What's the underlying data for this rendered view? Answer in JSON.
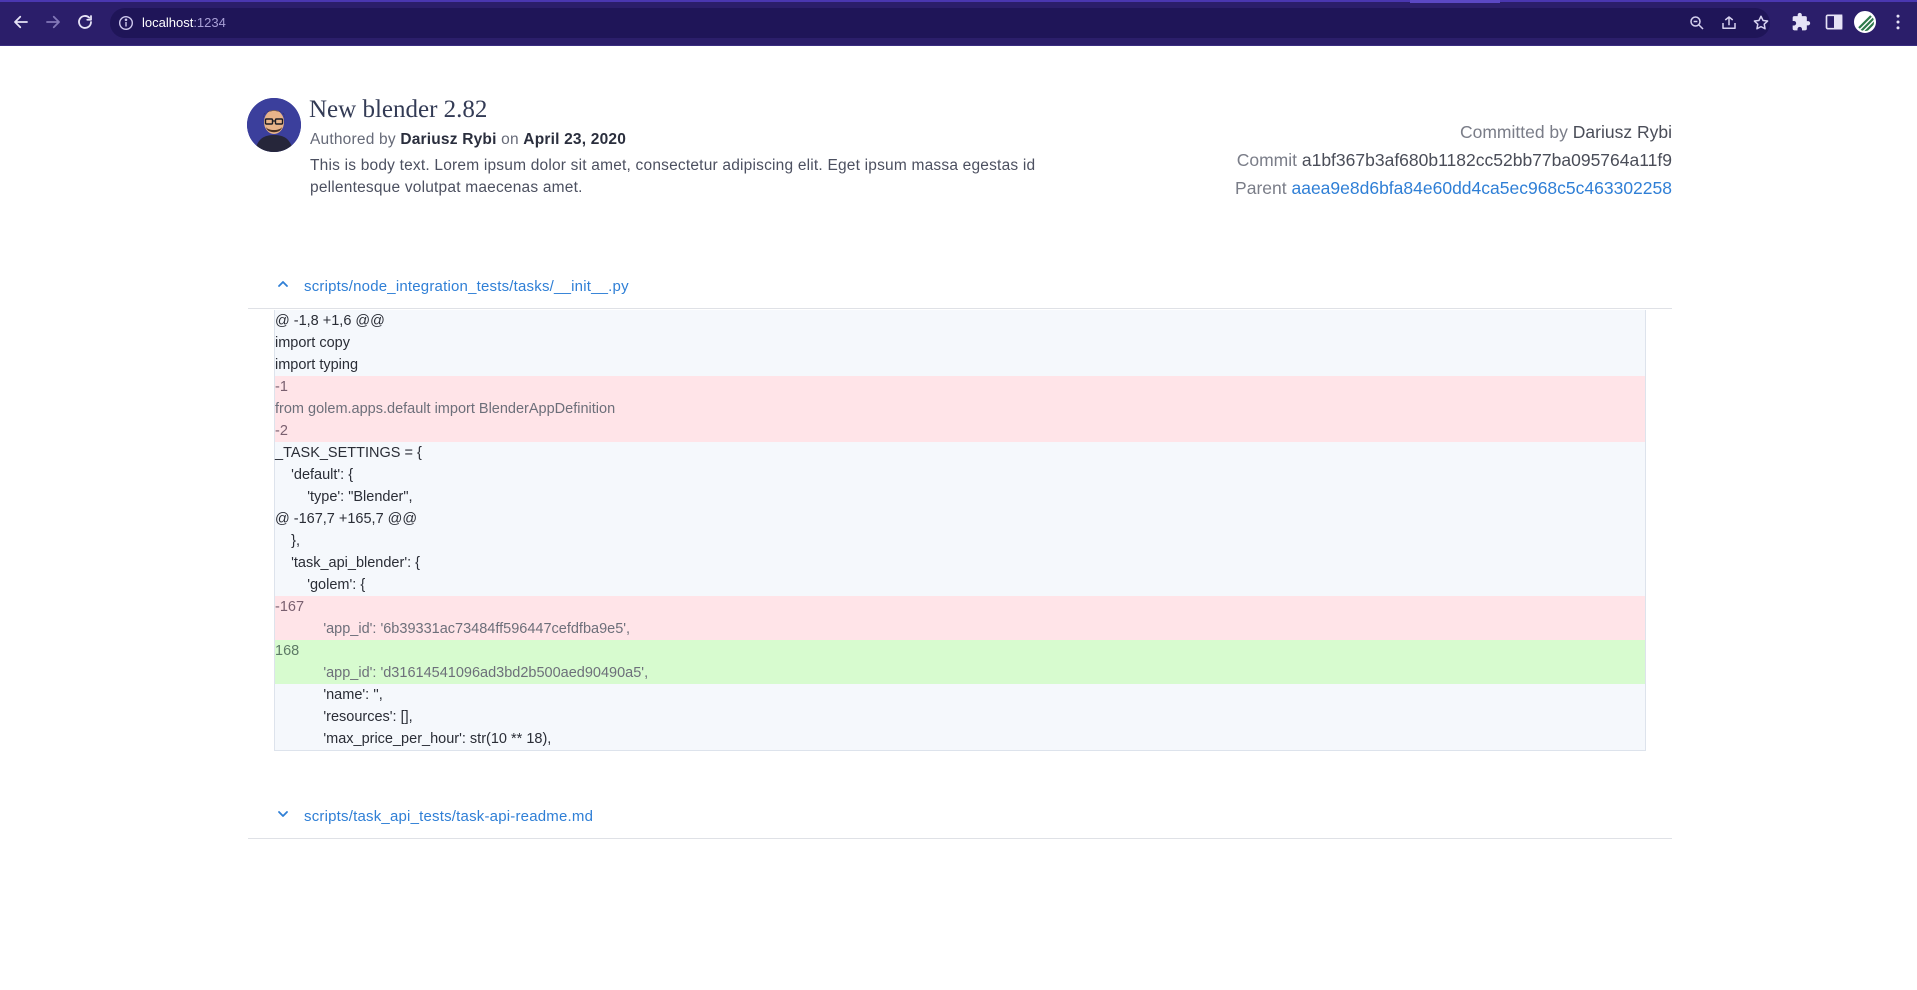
{
  "browser": {
    "url_host": "localhost",
    "url_port": ":1234"
  },
  "commit": {
    "title": "New blender 2.82",
    "authored_prefix": "Authored by",
    "author": "Dariusz Rybi",
    "on_label": "on",
    "date": "April 23, 2020",
    "body": "This is body text. Lorem ipsum dolor sit amet, consectetur adipiscing elit. Eget ipsum massa egestas id pellentesque volutpat maecenas amet.",
    "committed_label": "Committed by",
    "committer": "Dariusz Rybi",
    "commit_label": "Commit",
    "commit_hash": "a1bf367b3af680b1182cc52bb77ba095764a11f9",
    "parent_label": "Parent",
    "parent_hash": "aaea9e8d6bfa84e60dd4ca5ec968c5c463302258"
  },
  "files": [
    {
      "path": "scripts/node_integration_tests/tasks/__init__.py",
      "expanded": true,
      "lines": [
        {
          "text": "@ -1,8 +1,6 @@",
          "type": "ctx"
        },
        {
          "text": "import copy",
          "type": "ctx"
        },
        {
          "text": "import typing",
          "type": "ctx"
        },
        {
          "text": "-1",
          "type": "del-num"
        },
        {
          "text": "from golem.apps.default import BlenderAppDefinition",
          "type": "del"
        },
        {
          "text": "-2",
          "type": "del-num"
        },
        {
          "text": "_TASK_SETTINGS = {",
          "type": "ctx"
        },
        {
          "text": "    'default': {",
          "type": "ctx"
        },
        {
          "text": "        'type': \"Blender\",",
          "type": "ctx"
        },
        {
          "text": "@ -167,7 +165,7 @@",
          "type": "ctx"
        },
        {
          "text": "    },",
          "type": "ctx"
        },
        {
          "text": "    'task_api_blender': {",
          "type": "ctx"
        },
        {
          "text": "        'golem': {",
          "type": "ctx"
        },
        {
          "text": "-167",
          "type": "del-num"
        },
        {
          "text": "            'app_id': '6b39331ac73484ff596447cefdfba9e5',",
          "type": "del"
        },
        {
          "text": "168",
          "type": "add-num"
        },
        {
          "text": "            'app_id': 'd31614541096ad3bd2b500aed90490a5',",
          "type": "add"
        },
        {
          "text": "            'name': '',",
          "type": "ctx"
        },
        {
          "text": "            'resources': [],",
          "type": "ctx"
        },
        {
          "text": "            'max_price_per_hour': str(10 ** 18),",
          "type": "ctx"
        }
      ]
    },
    {
      "path": "scripts/task_api_tests/task-api-readme.md",
      "expanded": false
    }
  ]
}
